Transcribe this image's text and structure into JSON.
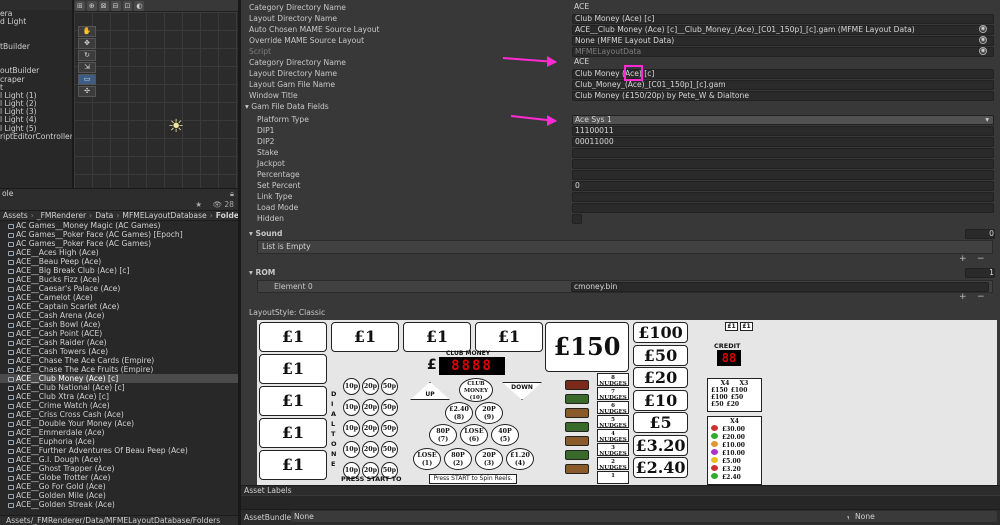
{
  "hierarchy": {
    "rows": [
      "era",
      "d Light",
      "",
      "",
      "tBuilder",
      "",
      "",
      "outBuilder",
      "craper",
      "t",
      "l Light (1)",
      "l Light (2)",
      "l Light (3)",
      "l Light (4)",
      "l Light (5)",
      "riptEditorController"
    ]
  },
  "scene": {
    "toolbar": [
      "⊞",
      "⊕",
      "⊠",
      "⊟",
      "⊡",
      "◐"
    ]
  },
  "project": {
    "panel_title": "ole",
    "breadcrumb": [
      "Assets",
      "_FMRenderer",
      "Data",
      "MFMELayoutDatabase",
      "Folders"
    ],
    "count": "28",
    "items": [
      "AC Games__Money Magic (AC Games)",
      "AC Games__Poker Face (AC Games) [Epoch]",
      "AC Games__Poker Face (AC Games)",
      "ACE__Aces High (Ace)",
      "ACE__Beau Peep (Ace)",
      "ACE__Big Break Club (Ace) [c]",
      "ACE__Bucks Fizz (Ace)",
      "ACE__Caesar's Palace (Ace)",
      "ACE__Camelot (Ace)",
      "ACE__Captain Scarlet (Ace)",
      "ACE__Cash Arena (Ace)",
      "ACE__Cash Bowl (Ace)",
      "ACE__Cash Point (ACE)",
      "ACE__Cash Raider (Ace)",
      "ACE__Cash Towers (Ace)",
      "ACE__Chase The Ace Cards (Empire)",
      "ACE__Chase The Ace Fruits (Empire)",
      "ACE__Club Money (Ace) [c]",
      "ACE__Club National (Ace) [c]",
      "ACE__Club Xtra (Ace) [c]",
      "ACE__Crime Watch (Ace)",
      "ACE__Criss Cross Cash (Ace)",
      "ACE__Double Your Money (Ace)",
      "ACE__Emmerdale (Ace)",
      "ACE__Euphoria (Ace)",
      "ACE__Further Adventures Of Beau Peep (Ace)",
      "ACE__G.I. Dough (Ace)",
      "ACE__Ghost Trapper (Ace)",
      "ACE__Globe Trotter (Ace)",
      "ACE__Go For Gold (Ace)",
      "ACE__Golden Mile (Ace)",
      "ACE__Golden Streak (Ace)"
    ],
    "selected_index": 17,
    "footer_path": "Assets/_FMRenderer/Data/MFMELayoutDatabase/Folders"
  },
  "inspector": {
    "rows": [
      {
        "label": "Category Directory Name",
        "value": "ACE"
      },
      {
        "label": "Layout Directory Name",
        "value": "Club Money (Ace) [c]"
      },
      {
        "label": "Auto Chosen MAME Source Layout",
        "value": "ACE__Club Money (Ace) [c]__Club_Money_(Ace)_[C01_150p]_[c].gam (MFME Layout Data)"
      },
      {
        "label": "Override MAME Source Layout",
        "value": "None (MFME Layout Data)"
      },
      {
        "label": "Script",
        "value": "MFMELayoutData"
      },
      {
        "label": "Category Directory Name",
        "value": "ACE"
      },
      {
        "label": "Layout Directory Name",
        "value": "Club Money (Ace) [c]"
      },
      {
        "label": "Layout Gam File Name",
        "value": "Club_Money_(Ace)_[C01_150p]_[c].gam"
      },
      {
        "label": "Window Title",
        "value": "Club Money (£150/20p) by Pete_W & Dialtone"
      },
      {
        "label": "Gam File Data Fields",
        "value": ""
      },
      {
        "label": "Platform Type",
        "value": "Ace Sys 1"
      },
      {
        "label": "DIP1",
        "value": "11100011"
      },
      {
        "label": "DIP2",
        "value": "00011000"
      },
      {
        "label": "Stake",
        "value": ""
      },
      {
        "label": "Jackpot",
        "value": ""
      },
      {
        "label": "Percentage",
        "value": ""
      },
      {
        "label": "Set Percent",
        "value": "0"
      },
      {
        "label": "Link Type",
        "value": ""
      },
      {
        "label": "Load Mode",
        "value": ""
      },
      {
        "label": "Hidden",
        "value": ""
      }
    ],
    "sound": {
      "label": "Sound",
      "count": "0",
      "empty_text": "List is Empty"
    },
    "rom": {
      "label": "ROM",
      "count": "1",
      "element_label": "Element 0",
      "element_value": "cmoney.bin"
    },
    "layout_style": "LayoutStyle: Classic",
    "plus": "+",
    "minus": "−"
  },
  "machine": {
    "left_prizes": [
      "£1",
      "£1",
      "£1",
      "£1"
    ],
    "left_column": [
      "£1",
      "£1",
      "£1",
      "£1"
    ],
    "jackpot": "£150",
    "club_money_label": "CLUB MONEY",
    "pound_sign": "£",
    "display_digits": "8888",
    "prize_ladder": [
      "£100",
      "£50",
      "£20",
      "£10",
      "£5",
      "£3.20",
      "£2.40"
    ],
    "credit_label": "CREDIT",
    "credit_digits": "88",
    "stake_buttons": [
      "£1",
      "£1"
    ],
    "dialtone_letters": [
      "D",
      "I",
      "A",
      "L",
      "T",
      "O",
      "N",
      "E"
    ],
    "stake_circles": [
      [
        "10p",
        "20p",
        "50p"
      ],
      [
        "10p",
        "20p",
        "50p"
      ],
      [
        "10p",
        "20p",
        "50p"
      ],
      [
        "10p",
        "20p",
        "50p"
      ],
      [
        "10p",
        "20p",
        "50p"
      ]
    ],
    "up_label": "UP",
    "down_label": "DOWN",
    "club_money_circle": "CLUB MONEY (10)",
    "circles": [
      {
        "t": "£2.40",
        "n": "(8)"
      },
      {
        "t": "20P",
        "n": "(9)"
      },
      {
        "t": "80P",
        "n": "(7)"
      },
      {
        "t": "LOSE",
        "n": "(6)"
      },
      {
        "t": "40P",
        "n": "(5)"
      },
      {
        "t": "LOSE",
        "n": "(1)"
      },
      {
        "t": "80P",
        "n": "(2)"
      },
      {
        "t": "20P",
        "n": "(3)"
      },
      {
        "t": "£1.20",
        "n": "(4)"
      }
    ],
    "nudges": [
      "8 NUDGES",
      "7 NUDGES",
      "6 NUDGES",
      "5 NUDGES",
      "4 NUDGES",
      "3 NUDGES",
      "2 NUDGES",
      "1"
    ],
    "press_start_to": "PRESS START TO",
    "spin_text": "Press START to Spin Reels.",
    "paytable_x4x3": {
      "header": [
        "X4",
        "X3"
      ],
      "rows": [
        [
          "£150",
          "£100"
        ],
        [
          "£100",
          "£50"
        ],
        [
          "£50",
          "£20"
        ]
      ]
    },
    "paytable_x4": {
      "header": "X4",
      "rows": [
        "£30.00",
        "£20.00",
        "£10.00",
        "£10.00",
        "£5.00",
        "£3.20",
        "£2.40"
      ]
    }
  },
  "bottom": {
    "asset_labels": "Asset Labels",
    "asset_bundle_label": "AssetBundle",
    "bundle_value": "None",
    "variant_value": "None"
  }
}
